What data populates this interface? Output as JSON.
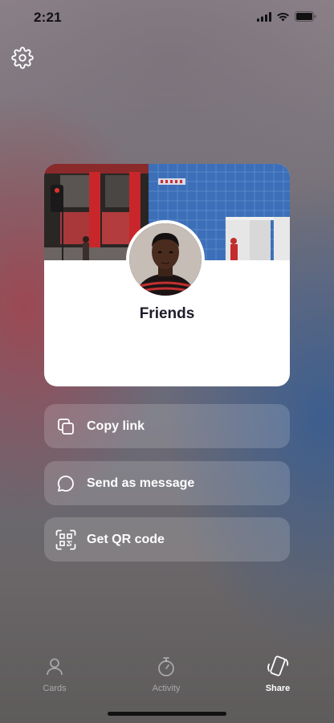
{
  "status_bar": {
    "time": "2:21"
  },
  "card": {
    "title": "Friends"
  },
  "actions": [
    {
      "label": "Copy link",
      "icon": "copy-icon"
    },
    {
      "label": "Send as message",
      "icon": "message-icon"
    },
    {
      "label": "Get QR code",
      "icon": "qr-code-icon"
    }
  ],
  "tabs": [
    {
      "label": "Cards",
      "icon": "person-icon",
      "active": false
    },
    {
      "label": "Activity",
      "icon": "stopwatch-icon",
      "active": false
    },
    {
      "label": "Share",
      "icon": "phone-share-icon",
      "active": true
    }
  ],
  "colors": {
    "card_title": "#1c1c2a",
    "action_bg": "rgba(255,255,255,0.16)",
    "tab_active": "#ffffff",
    "tab_inactive": "rgba(255,255,255,0.45)"
  }
}
